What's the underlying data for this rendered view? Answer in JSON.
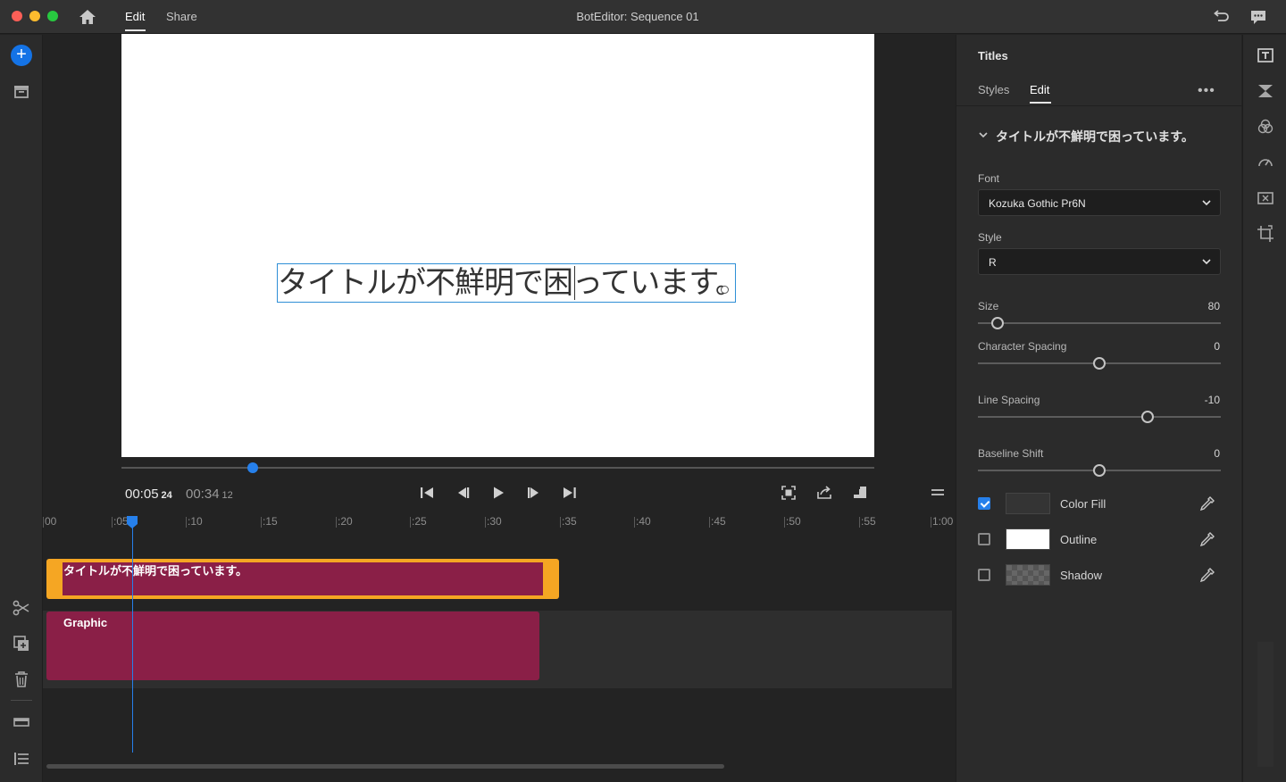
{
  "window": {
    "title": "BotEditor: Sequence 01",
    "nav": [
      {
        "label": "Edit",
        "active": true
      },
      {
        "label": "Share",
        "active": false
      }
    ]
  },
  "preview": {
    "title_text": "タイトルが不鮮明で困っています。"
  },
  "transport": {
    "current_time": "00:05",
    "current_frame": "24",
    "duration_time": "00:34",
    "duration_frame": "12"
  },
  "timeline": {
    "ruler": [
      "00",
      ":05",
      ":10",
      ":15",
      ":20",
      ":25",
      ":30",
      ":35",
      ":40",
      ":45",
      ":50",
      ":55",
      "1:00"
    ],
    "clips": {
      "title_clip": "タイトルが不鮮明で困っています。",
      "graphic_clip": "Graphic"
    }
  },
  "panel": {
    "title": "Titles",
    "tabs": [
      "Styles",
      "Edit"
    ],
    "more": "•••",
    "section": "タイトルが不鮮明で困っています。",
    "font_label": "Font",
    "font_value": "Kozuka Gothic Pr6N",
    "style_label": "Style",
    "style_value": "R",
    "sliders": [
      {
        "label": "Size",
        "value": "80",
        "fraction": 0.08
      },
      {
        "label": "Character Spacing",
        "value": "0",
        "fraction": 0.5
      },
      {
        "label": "Line Spacing",
        "value": "-10",
        "fraction": 0.7
      },
      {
        "label": "Baseline Shift",
        "value": "0",
        "fraction": 0.5
      }
    ],
    "appearance": [
      {
        "label": "Color Fill",
        "checked": true
      },
      {
        "label": "Outline",
        "checked": false
      },
      {
        "label": "Shadow",
        "checked": false
      }
    ]
  },
  "colors": {
    "accent": "#2680eb",
    "clip_title_border": "#f5a623",
    "clip_fill": "#8a1f47"
  },
  "icons": {
    "left": [
      "add-media-icon",
      "project-bin-icon",
      "scissors-icon",
      "duplicate-icon",
      "trash-icon",
      "track-icon",
      "list-icon"
    ],
    "right": [
      "titles-icon",
      "transitions-icon",
      "color-icon",
      "speed-icon",
      "audio-icon",
      "crop-icon"
    ]
  }
}
